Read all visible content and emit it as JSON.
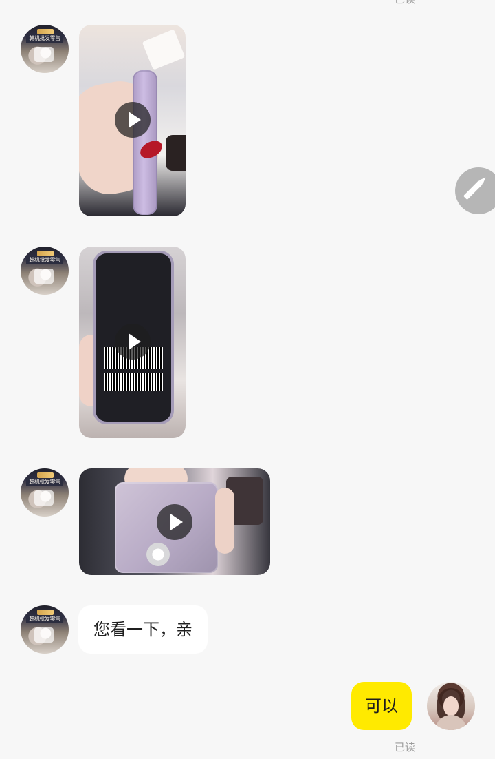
{
  "status": {
    "top_read": "已读",
    "bottom_read": "已读"
  },
  "shop": {
    "avatar_banner": "韩机批发零售"
  },
  "messages": [
    {
      "type": "video"
    },
    {
      "type": "video"
    },
    {
      "type": "video"
    },
    {
      "type": "text",
      "text": "您看一下，亲"
    },
    {
      "type": "text_mine",
      "text": "可以"
    }
  ],
  "icons": {
    "play": "play-icon",
    "edit": "pencil-icon"
  },
  "colors": {
    "background": "#f7f7f7",
    "my_bubble": "#ffea00",
    "their_bubble": "#ffffff",
    "fab": "#b6b6b6"
  }
}
